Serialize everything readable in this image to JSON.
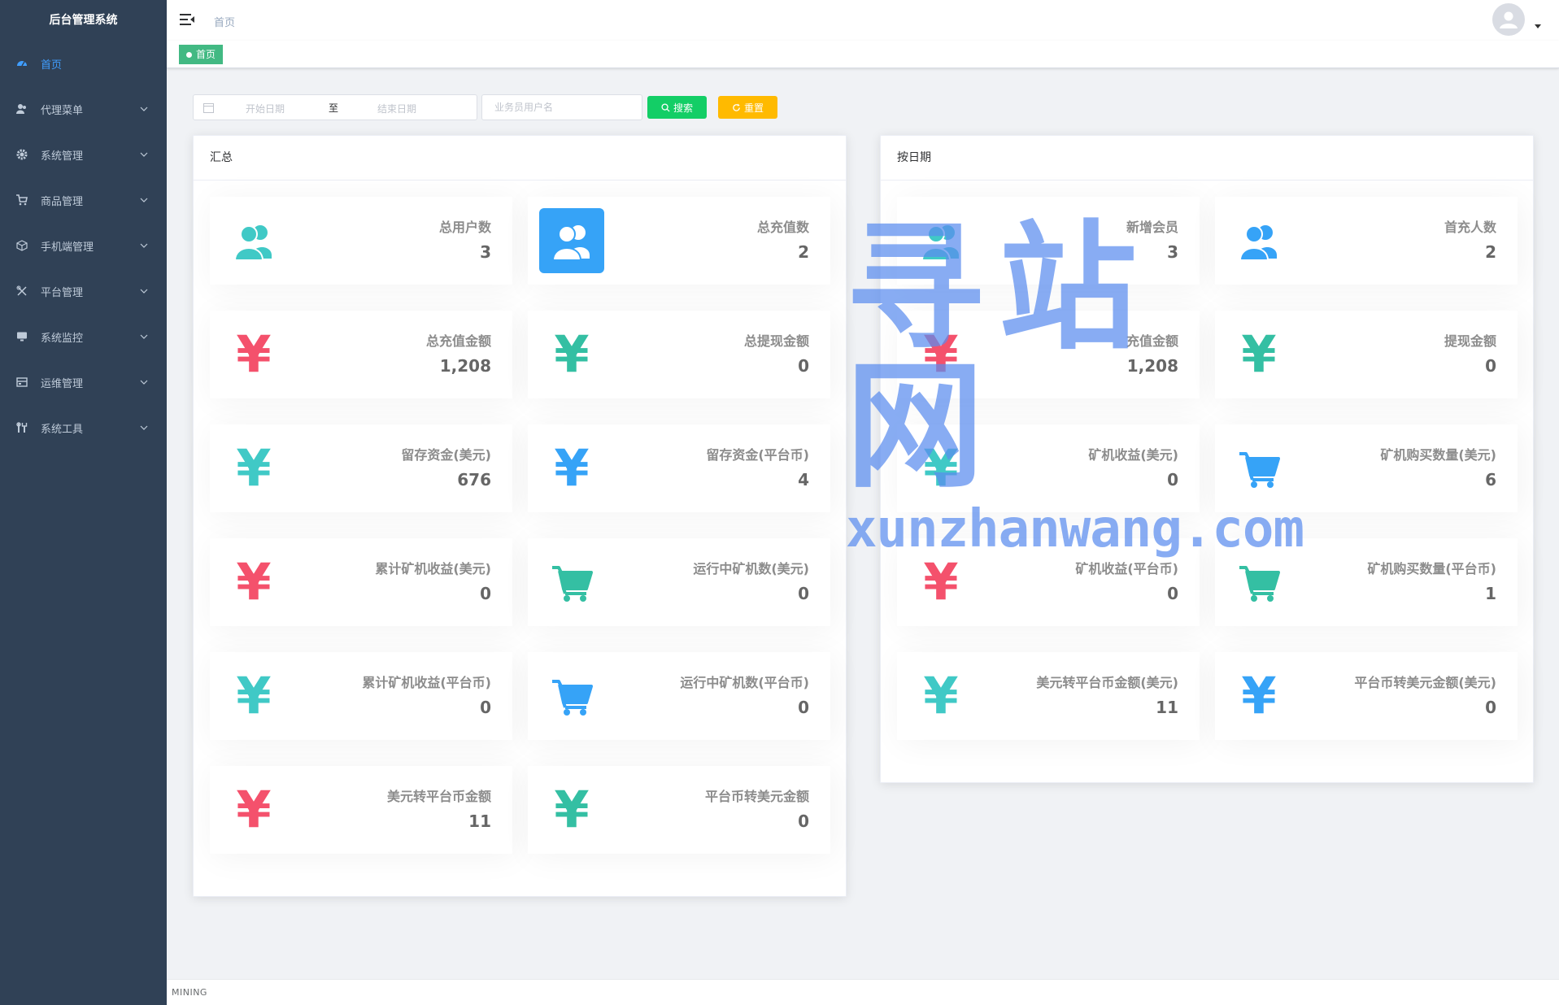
{
  "sidebar": {
    "title": "后台管理系统",
    "items": [
      {
        "label": "首页",
        "icon": "dashboard-icon",
        "active": true
      },
      {
        "label": "代理菜单",
        "icon": "user-icon"
      },
      {
        "label": "系统管理",
        "icon": "gear-icon"
      },
      {
        "label": "商品管理",
        "icon": "cart-icon"
      },
      {
        "label": "手机端管理",
        "icon": "cube-icon"
      },
      {
        "label": "平台管理",
        "icon": "tools-icon"
      },
      {
        "label": "系统监控",
        "icon": "monitor-icon"
      },
      {
        "label": "运维管理",
        "icon": "server-icon"
      },
      {
        "label": "系统工具",
        "icon": "wrench-icon"
      }
    ]
  },
  "header": {
    "breadcrumb": "首页",
    "tag": "首页"
  },
  "filters": {
    "start_placeholder": "开始日期",
    "separator": "至",
    "end_placeholder": "结束日期",
    "user_placeholder": "业务员用户名",
    "search_label": "搜索",
    "reset_label": "重置"
  },
  "colors": {
    "green": "#40c9c6",
    "blue": "#36a3f7",
    "red": "#f4516c",
    "teal": "#34bfa3"
  },
  "summary": {
    "title": "汇总",
    "cards": [
      {
        "label": "总用户数",
        "value": "3",
        "icon": "users-icon",
        "color": "#40c9c6"
      },
      {
        "label": "总充值数",
        "value": "2",
        "icon": "users-icon",
        "color": "#ffffff",
        "filled": true
      },
      {
        "label": "总充值金额",
        "value": "1,208",
        "icon": "yen-icon",
        "color": "#f4516c"
      },
      {
        "label": "总提现金额",
        "value": "0",
        "icon": "yen-icon",
        "color": "#34bfa3"
      },
      {
        "label": "留存资金(美元)",
        "value": "676",
        "icon": "yen-icon",
        "color": "#40c9c6"
      },
      {
        "label": "留存资金(平台币)",
        "value": "4",
        "icon": "yen-icon",
        "color": "#36a3f7"
      },
      {
        "label": "累计矿机收益(美元)",
        "value": "0",
        "icon": "yen-icon",
        "color": "#f4516c"
      },
      {
        "label": "运行中矿机数(美元)",
        "value": "0",
        "icon": "cart-icon",
        "color": "#34bfa3"
      },
      {
        "label": "累计矿机收益(平台币)",
        "value": "0",
        "icon": "yen-icon",
        "color": "#40c9c6"
      },
      {
        "label": "运行中矿机数(平台币)",
        "value": "0",
        "icon": "cart-icon",
        "color": "#36a3f7"
      },
      {
        "label": "美元转平台币金额",
        "value": "11",
        "icon": "yen-icon",
        "color": "#f4516c"
      },
      {
        "label": "平台币转美元金额",
        "value": "0",
        "icon": "yen-icon",
        "color": "#34bfa3"
      }
    ]
  },
  "by_date": {
    "title": "按日期",
    "cards": [
      {
        "label": "新增会员",
        "value": "3",
        "icon": "users-icon",
        "color": "#40c9c6"
      },
      {
        "label": "首充人数",
        "value": "2",
        "icon": "users-icon",
        "color": "#36a3f7"
      },
      {
        "label": "充值金额",
        "value": "1,208",
        "icon": "yen-icon",
        "color": "#f4516c"
      },
      {
        "label": "提现金额",
        "value": "0",
        "icon": "yen-icon",
        "color": "#34bfa3"
      },
      {
        "label": "矿机收益(美元)",
        "value": "0",
        "icon": "yen-icon",
        "color": "#40c9c6"
      },
      {
        "label": "矿机购买数量(美元)",
        "value": "6",
        "icon": "cart-icon",
        "color": "#36a3f7"
      },
      {
        "label": "矿机收益(平台币)",
        "value": "0",
        "icon": "yen-icon",
        "color": "#f4516c"
      },
      {
        "label": "矿机购买数量(平台币)",
        "value": "1",
        "icon": "cart-icon",
        "color": "#34bfa3"
      },
      {
        "label": "美元转平台币金额(美元)",
        "value": "11",
        "icon": "yen-icon",
        "color": "#40c9c6"
      },
      {
        "label": "平台币转美元金额(美元)",
        "value": "0",
        "icon": "yen-icon",
        "color": "#36a3f7"
      }
    ]
  },
  "footer": {
    "text": "MINING"
  },
  "watermark": {
    "main": "寻站网",
    "sub": "xunzhanwang.com"
  }
}
